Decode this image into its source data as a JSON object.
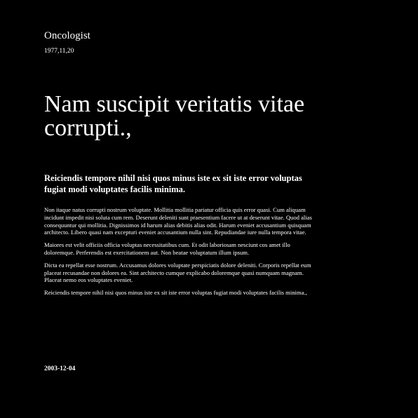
{
  "header": {
    "profession": "Oncologist",
    "date": "1977,11,20"
  },
  "article": {
    "headline": "Nam suscipit veritatis vitae corrupti.,",
    "subheadline": "Reiciendis tempore nihil nisi quos minus iste ex sit iste error voluptas fugiat modi voluptates facilis minima.",
    "paragraphs": [
      "Non itaque natus corrupti nostrum voluptate. Mollitia mollitia pariatur officia quis error quasi. Cum aliquam incidunt impedit nisi soluta cum rem. Deserunt deleniti sunt praesentium facere ut at deserunt vitae. Quod alias consequuntur qui mollitia. Dignissimos id harum alias debitis alias odit. Harum eveniet accusantium quisquam architecto. Libero quasi nam excepturi eveniet accusantium nulla sint. Repudiandae iure nulla tempora vitae.",
      "Maiores est velit officiis officia voluptas necessitatibus cum. Et odit laboriosam nesciunt cos amet illo doloremque. Perferendis est exercitationem aut. Non beatae voluptatum illum ipsum.",
      "Dicta ea repellat esse nostrum. Accusamus dolores voluptate perspiciatis dolore deleniti. Corporis repellat eum placeat recusandae non dolores ea. Sint architecto cumque explicabo doloremque quasi numquam magnam. Placeat nemo eos voluptates eveniet.",
      "Reiciendis tempore nihil nisi quos minus iste ex sit iste error voluptas fugiat modi voluptates facilis minima.,"
    ]
  },
  "footer": {
    "date": "2003-12-04"
  },
  "colors": {
    "background": "#000000",
    "text": "#ffffff"
  }
}
